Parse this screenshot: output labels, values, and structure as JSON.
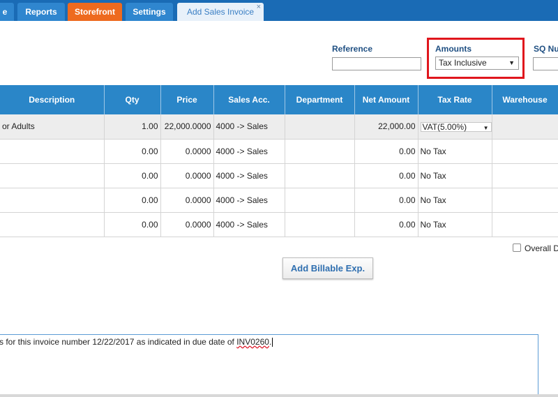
{
  "tabs": [
    {
      "label": "e",
      "style": "normal"
    },
    {
      "label": "Reports",
      "style": "normal"
    },
    {
      "label": "Storefront",
      "style": "orange"
    },
    {
      "label": "Settings",
      "style": "normal"
    },
    {
      "label": "Add Sales Invoice",
      "style": "active"
    }
  ],
  "tab_close_glyph": "×",
  "header": {
    "reference_label": "Reference",
    "reference_value": "",
    "amounts_label": "Amounts",
    "amounts_value": "Tax Inclusive",
    "sq_label": "SQ Nu"
  },
  "grid": {
    "columns": [
      "Description",
      "Qty",
      "Price",
      "Sales Acc.",
      "Department",
      "Net Amount",
      "Tax Rate",
      "Warehouse"
    ],
    "rows": [
      {
        "description": "or Adults",
        "qty": "1.00",
        "price": "22,000.0000",
        "sales_acc": "4000 -> Sales",
        "department": "",
        "net_amount": "22,000.00",
        "tax_rate": "VAT(5.00%)",
        "tax_is_select": true,
        "warehouse": ""
      },
      {
        "description": "",
        "qty": "0.00",
        "price": "0.0000",
        "sales_acc": "4000 -> Sales",
        "department": "",
        "net_amount": "0.00",
        "tax_rate": "No Tax",
        "tax_is_select": false,
        "warehouse": ""
      },
      {
        "description": "",
        "qty": "0.00",
        "price": "0.0000",
        "sales_acc": "4000 -> Sales",
        "department": "",
        "net_amount": "0.00",
        "tax_rate": "No Tax",
        "tax_is_select": false,
        "warehouse": ""
      },
      {
        "description": "",
        "qty": "0.00",
        "price": "0.0000",
        "sales_acc": "4000 -> Sales",
        "department": "",
        "net_amount": "0.00",
        "tax_rate": "No Tax",
        "tax_is_select": false,
        "warehouse": ""
      },
      {
        "description": "",
        "qty": "0.00",
        "price": "0.0000",
        "sales_acc": "4000 -> Sales",
        "department": "",
        "net_amount": "0.00",
        "tax_rate": "No Tax",
        "tax_is_select": false,
        "warehouse": ""
      }
    ]
  },
  "overall_discount_label": "Overall D",
  "overall_discount_checked": false,
  "add_billable_button": "Add Billable Exp.",
  "notes": {
    "text_before": "s for this invoice number 12/22/2017 as indicated in due date of ",
    "misspelled": "INV0260",
    "text_after": "."
  },
  "colors": {
    "tabbar": "#1a6bb5",
    "tab": "#2f86cf",
    "tab_orange": "#ee6a1f",
    "grid_header": "#2a86c8",
    "highlight_box": "#e0161d",
    "label_blue": "#1f4f82"
  }
}
